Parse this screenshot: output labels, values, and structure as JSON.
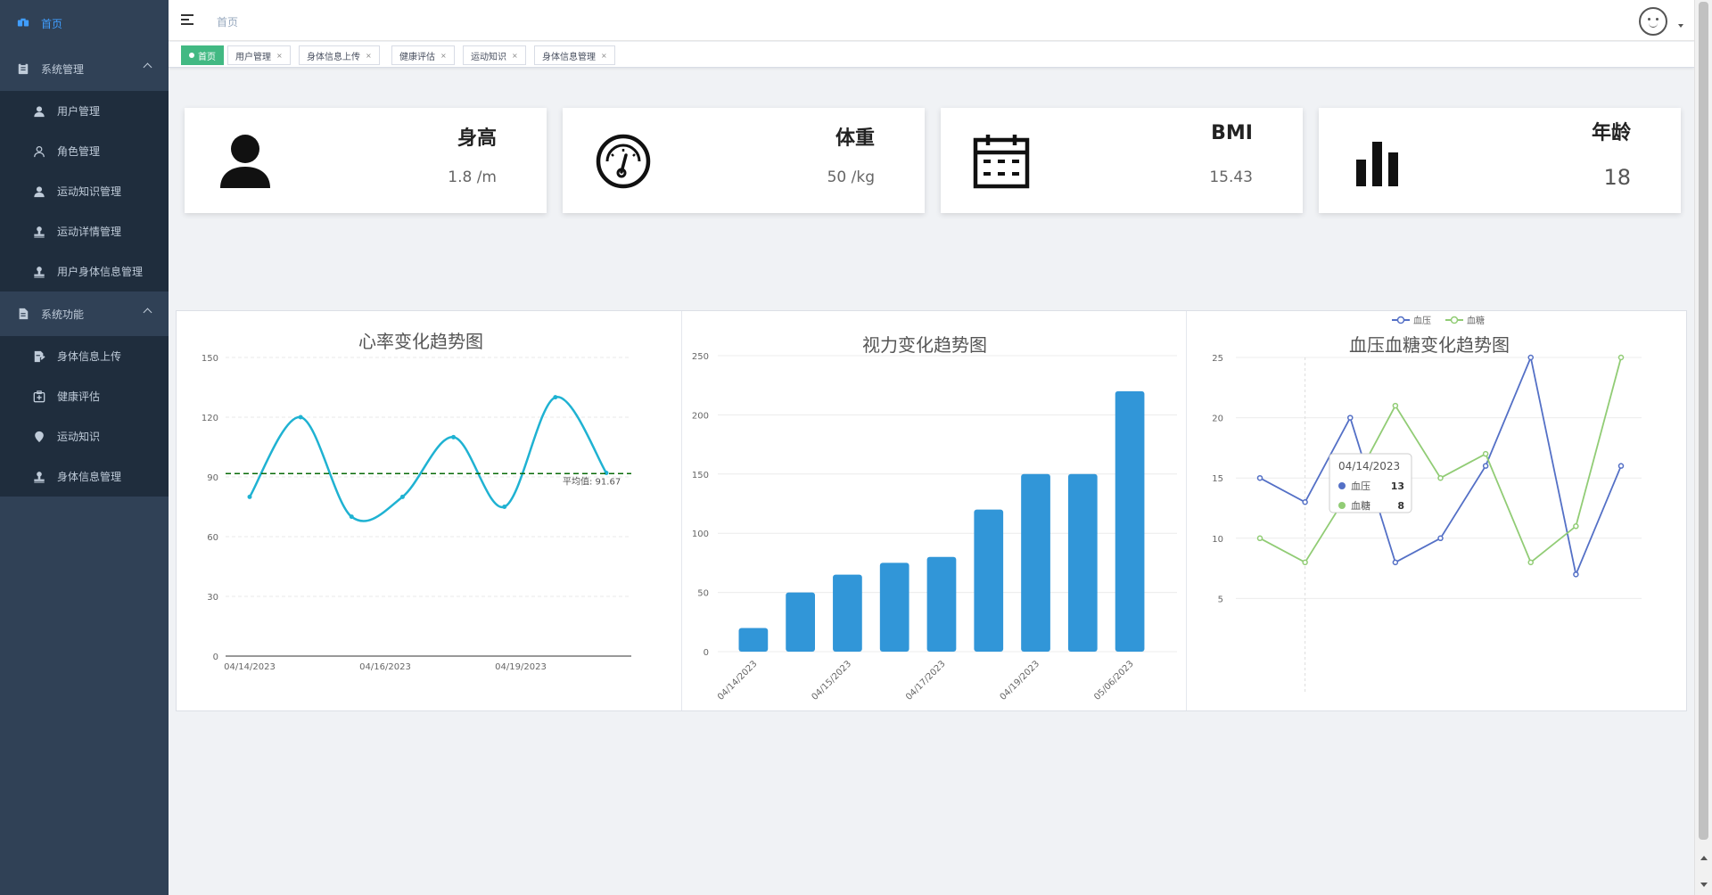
{
  "sidebar": {
    "home": "首页",
    "groups": [
      {
        "label": "系统管理",
        "items": [
          "用户管理",
          "角色管理",
          "运动知识管理",
          "运动详情管理",
          "用户身体信息管理"
        ]
      },
      {
        "label": "系统功能",
        "items": [
          "身体信息上传",
          "健康评估",
          "运动知识",
          "身体信息管理"
        ]
      }
    ]
  },
  "topbar": {
    "breadcrumb": "首页"
  },
  "tags": [
    "首页",
    "用户管理",
    "身体信息上传",
    "健康评估",
    "运动知识",
    "身体信息管理"
  ],
  "cards": [
    {
      "title": "身高",
      "value": "1.8 /m",
      "icon": "user-icon"
    },
    {
      "title": "体重",
      "value": "50 /kg",
      "icon": "gauge-icon"
    },
    {
      "title": "BMI",
      "value": "15.43",
      "icon": "calendar-icon"
    },
    {
      "title": "年龄",
      "value": "18",
      "icon": "bar-chart-icon"
    }
  ],
  "colors": {
    "sidebar": "#304156",
    "sidebar_sub": "#1f2d3d",
    "active": "#409eff",
    "tag_active": "#42b983",
    "heart": "#1fb2d2",
    "bar": "#3196d8",
    "bp": "#5470c6",
    "bs": "#91cc75"
  },
  "chart_data": [
    {
      "type": "line",
      "title": "心率变化趋势图",
      "x": [
        "04/14/2023",
        "",
        "",
        "04/16/2023",
        "",
        "",
        "04/19/2023"
      ],
      "values": [
        80,
        120,
        70,
        80,
        110,
        75,
        130,
        92
      ],
      "ylim": [
        0,
        150
      ],
      "yticks": [
        0,
        30,
        60,
        90,
        120,
        150
      ],
      "mark_line": {
        "label": "平均值: 91.67",
        "value": 91.67
      }
    },
    {
      "type": "bar",
      "title": "视力变化趋势图",
      "categories": [
        "04/14/2023",
        "",
        "04/15/2023",
        "",
        "04/17/2023",
        "",
        "04/19/2023",
        "",
        "05/06/2023"
      ],
      "tick_labels": [
        "04/14/2023",
        "04/15/2023",
        "04/17/2023",
        "04/19/2023",
        "05/06/2023"
      ],
      "values": [
        20,
        50,
        65,
        75,
        80,
        120,
        150,
        150,
        220
      ],
      "ylim": [
        0,
        250
      ],
      "yticks": [
        0,
        50,
        100,
        150,
        200,
        250
      ]
    },
    {
      "type": "line",
      "title": "血压血糖变化趋势图",
      "legend": [
        "血压",
        "血糖"
      ],
      "series": [
        {
          "name": "血压",
          "values": [
            15,
            13,
            20,
            8,
            10,
            16,
            25,
            7,
            16
          ]
        },
        {
          "name": "血糖",
          "values": [
            10,
            8,
            14,
            21,
            15,
            17,
            8,
            11,
            25
          ]
        }
      ],
      "ylim": [
        0,
        25
      ],
      "yticks": [
        5,
        10,
        15,
        20,
        25
      ],
      "tooltip": {
        "date": "04/14/2023",
        "rows": [
          {
            "name": "血压",
            "value": "13"
          },
          {
            "name": "血糖",
            "value": "8"
          }
        ]
      }
    }
  ]
}
